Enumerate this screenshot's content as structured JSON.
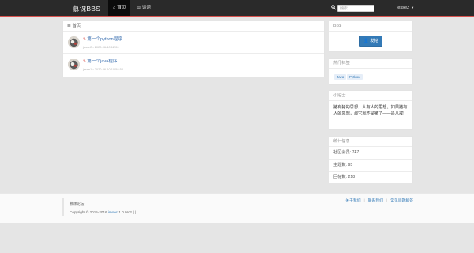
{
  "navbar": {
    "brand": "慕课BBS",
    "nav_home": "首页",
    "nav_topics": "话题",
    "search_placeholder": "搜索",
    "username": "jesse2"
  },
  "main": {
    "panel_title": "首页",
    "topics": [
      {
        "title": "第一个python程序",
        "meta": "jesse2 • 2020-06-10 12:00"
      },
      {
        "title": "第一个java程序",
        "meta": "jesse1 • 2020-06-10 10:58:54"
      }
    ]
  },
  "sidebar": {
    "bbs_title": "BBS",
    "post_button": "发帖",
    "tags_title": "热门标签",
    "tags": [
      "Java",
      "Python"
    ],
    "tips_title": "小贴士",
    "tips_text": "猪有猪的思想，人有人的思想。如果猪有人的思想，那它就不是猪了——是八戒!",
    "stats_title": "统计信息",
    "stats": [
      "社区会员: 747",
      "主题数: 95",
      "回帖数: 218"
    ]
  },
  "footer": {
    "site_name": "慕课论坛",
    "copyright_prefix": "Copyright © 2015-2016 ",
    "copyright_link": "imooc",
    "copyright_suffix": " 1.0.0rc2  |  |",
    "links": [
      "关于我们",
      "联系我们",
      "常见问题解答"
    ]
  },
  "colors": {
    "navbar_bg": "#2a2a2a",
    "navbar_accent": "#d9534f",
    "link": "#337ab7",
    "primary_button": "#337ab7"
  }
}
